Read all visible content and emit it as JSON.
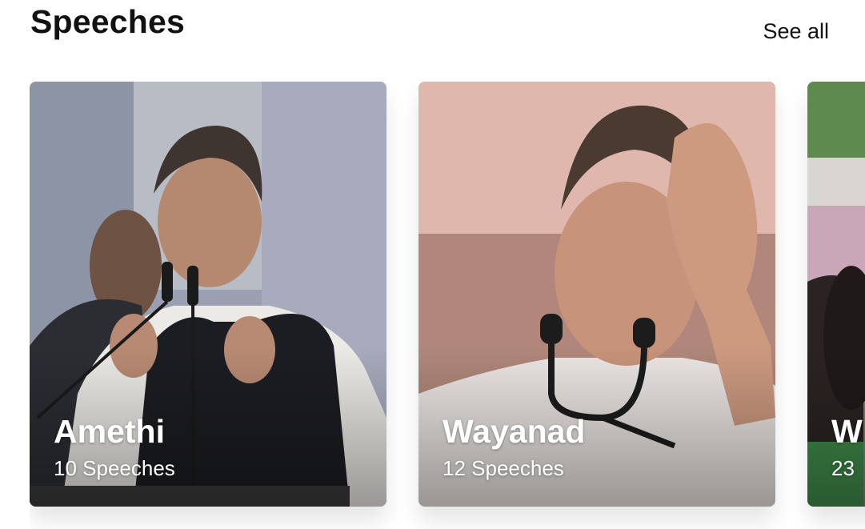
{
  "section": {
    "title": "Speeches",
    "see_all_label": "See all"
  },
  "cards": [
    {
      "title": "Amethi",
      "subtitle": "10 Speeches",
      "image": "man-speaking-at-microphone-photo"
    },
    {
      "title": "Wayanad",
      "subtitle": "12 Speeches",
      "image": "man-speaking-raised-hand-photo"
    },
    {
      "title": "W",
      "subtitle": "23",
      "image": "crowd-outdoor-photo"
    }
  ],
  "colors": {
    "text": "#111111",
    "card_text": "#ffffff",
    "background": "#ffffff"
  }
}
